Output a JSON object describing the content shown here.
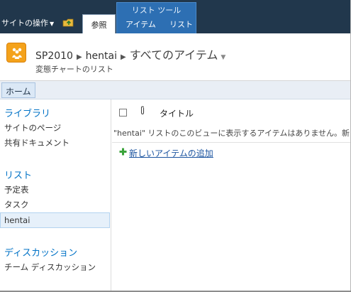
{
  "ribbon": {
    "site_actions": "サイトの操作",
    "browse_tab": "参照",
    "contextual_group": "リスト ツール",
    "contextual_tabs": [
      "アイテム",
      "リスト"
    ]
  },
  "titlebar": {
    "site": "SP2010",
    "list": "hentai",
    "view": "すべてのアイテム",
    "description": "変態チャートのリスト"
  },
  "topnav": {
    "home": "ホーム"
  },
  "quicklaunch": {
    "libraries_heading": "ライブラリ",
    "libraries": [
      "サイトのページ",
      "共有ドキュメント"
    ],
    "lists_heading": "リスト",
    "lists": [
      "予定表",
      "タスク",
      "hentai"
    ],
    "discussions_heading": "ディスカッション",
    "discussions": [
      "チーム ディスカッション"
    ]
  },
  "content": {
    "column_title": "タイトル",
    "empty_message": "\"hentai\" リストのこのビューに表示するアイテムはありません。新しいア",
    "add_new_item": "新しいアイテムの追加"
  },
  "colors": {
    "ribbon_bg": "#21374c",
    "contextual_bg": "#2d6fb3",
    "link_blue": "#0072c6",
    "add_green": "#3aa33a"
  }
}
